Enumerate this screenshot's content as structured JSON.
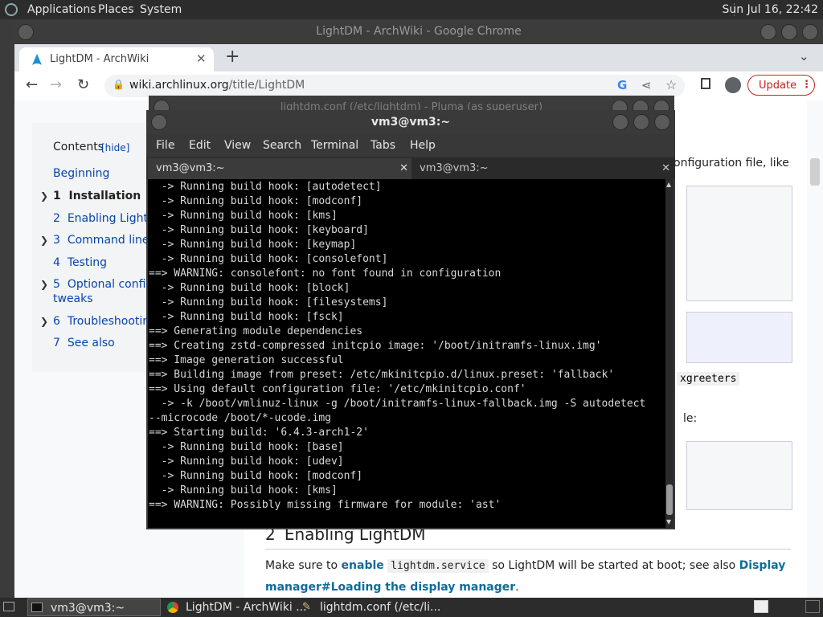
{
  "top_panel": {
    "menus": [
      "Applications",
      "Places",
      "System"
    ],
    "clock": "Sun Jul 16, 22:42"
  },
  "chrome": {
    "window_title": "LightDM - ArchWiki - Google Chrome",
    "tab_title": "LightDM - ArchWiki",
    "url_domain": "wiki.archlinux.org",
    "url_path": "/title/LightDM",
    "update_label": "Update"
  },
  "wiki": {
    "toc_title": "Contents",
    "toc_hide": "[hide]",
    "toc_items": [
      {
        "num": "",
        "label": "Beginning"
      },
      {
        "num": "1",
        "label": "Installation"
      },
      {
        "num": "2",
        "label": "Enabling LightDM"
      },
      {
        "num": "3",
        "label": "Command line to"
      },
      {
        "num": "4",
        "label": "Testing"
      },
      {
        "num": "5",
        "label": "Optional configu"
      },
      {
        "num": "",
        "label": "tweaks"
      },
      {
        "num": "6",
        "label": "Troubleshooting"
      },
      {
        "num": "7",
        "label": "See also"
      }
    ],
    "right_text_1": "onfiguration file, like",
    "right_code": "xgreeters",
    "right_text_2": "le:",
    "section_num": "2",
    "section_title": "Enabling LightDM",
    "para_1": "Make sure to",
    "para_link_1": "enable",
    "para_code": "lightdm.service",
    "para_2": "so LightDM will be started at boot; see also",
    "para_link_2": "Display",
    "para_link_3": "manager#Loading the display manager",
    "para_end": "."
  },
  "pluma": {
    "title": "lightdm.conf (/etc/lightdm) - Pluma (as superuser)"
  },
  "terminal": {
    "title": "vm3@vm3:~",
    "menu": [
      "File",
      "Edit",
      "View",
      "Search",
      "Terminal",
      "Tabs",
      "Help"
    ],
    "tabs": [
      "vm3@vm3:~",
      "vm3@vm3:~"
    ],
    "lines": [
      "  -> Running build hook: [autodetect]",
      "  -> Running build hook: [modconf]",
      "  -> Running build hook: [kms]",
      "  -> Running build hook: [keyboard]",
      "  -> Running build hook: [keymap]",
      "  -> Running build hook: [consolefont]",
      "==> WARNING: consolefont: no font found in configuration",
      "  -> Running build hook: [block]",
      "  -> Running build hook: [filesystems]",
      "  -> Running build hook: [fsck]",
      "==> Generating module dependencies",
      "==> Creating zstd-compressed initcpio image: '/boot/initramfs-linux.img'",
      "==> Image generation successful",
      "==> Building image from preset: /etc/mkinitcpio.d/linux.preset: 'fallback'",
      "==> Using default configuration file: '/etc/mkinitcpio.conf'",
      "  -> -k /boot/vmlinuz-linux -g /boot/initramfs-linux-fallback.img -S autodetect",
      "--microcode /boot/*-ucode.img",
      "==> Starting build: '6.4.3-arch1-2'",
      "  -> Running build hook: [base]",
      "  -> Running build hook: [udev]",
      "  -> Running build hook: [modconf]",
      "  -> Running build hook: [kms]",
      "==> WARNING: Possibly missing firmware for module: 'ast'"
    ]
  },
  "taskbar": {
    "tasks": [
      "vm3@vm3:~",
      "LightDM - ArchWiki ...",
      "lightdm.conf (/etc/li..."
    ]
  },
  "colors": {
    "accent_link": "#0645ad",
    "update_red": "#c5221f"
  }
}
